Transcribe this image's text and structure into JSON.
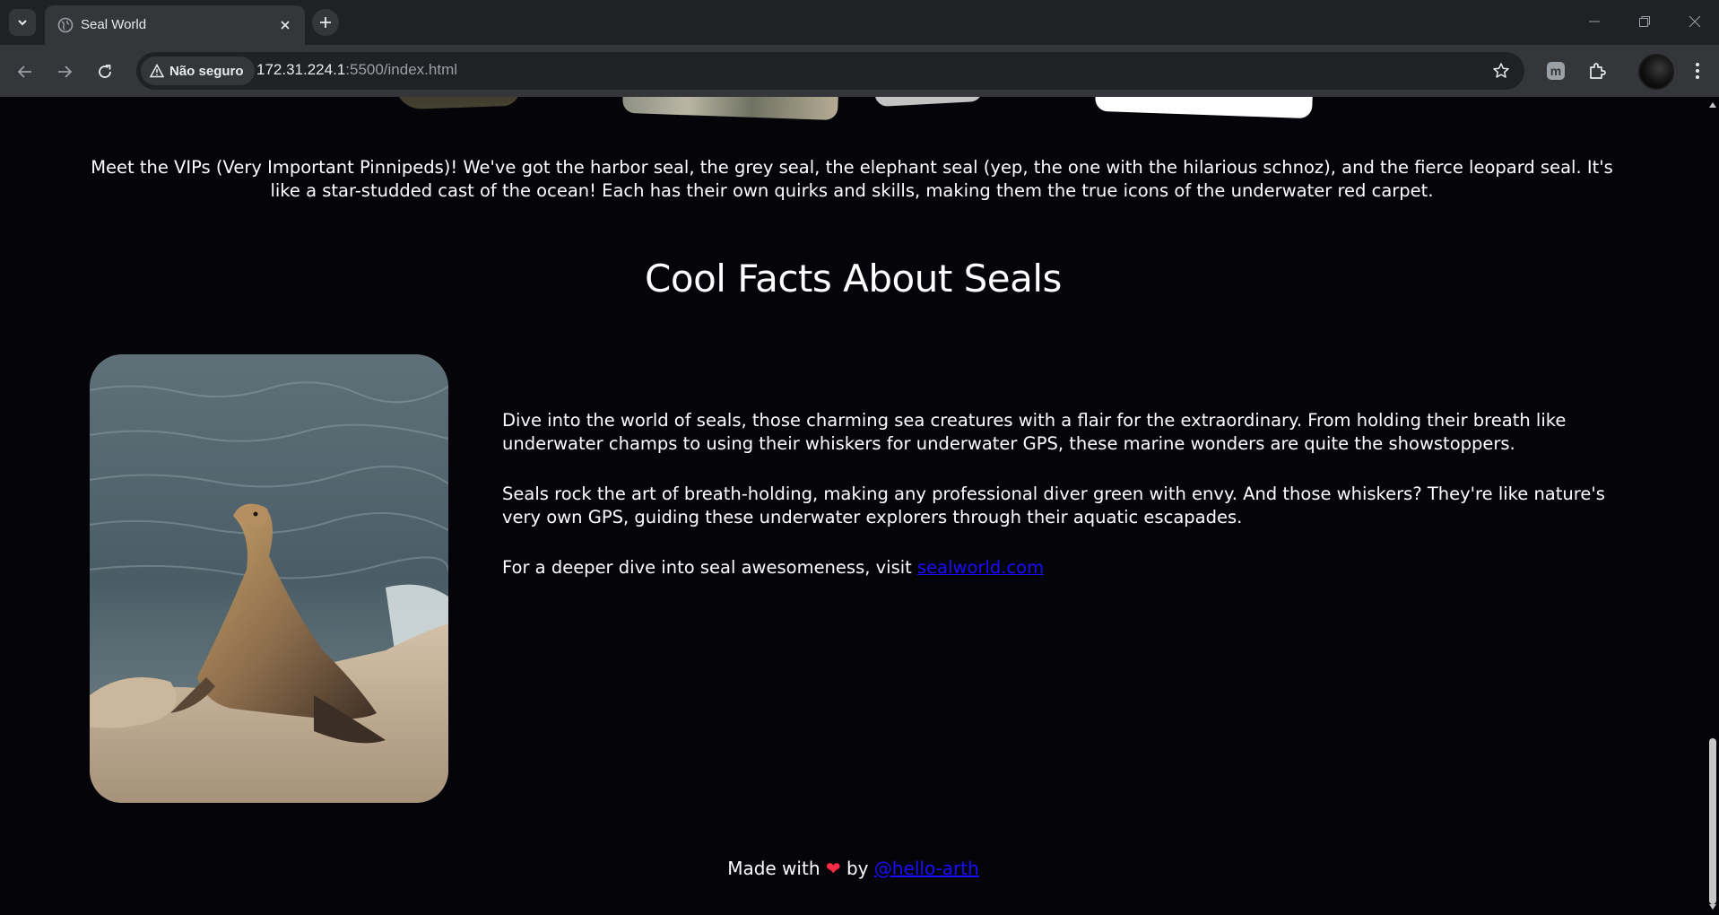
{
  "browser": {
    "tab_title": "Seal World",
    "security_label": "Não seguro",
    "url_host": "172.31.224.1",
    "url_path": ":5500/index.html"
  },
  "page": {
    "intro_text": "Meet the VIPs (Very Important Pinnipeds)! We've got the harbor seal, the grey seal, the elephant seal (yep, the one with the hilarious schnoz), and the fierce leopard seal. It's like a star-studded cast of the ocean! Each has their own quirks and skills, making them the true icons of the underwater red carpet.",
    "facts_heading": "Cool Facts About Seals",
    "facts_paragraph_1": "Dive into the world of seals, those charming sea creatures with a flair for the extraordinary. From holding their breath like underwater champs to using their whiskers for underwater GPS, these marine wonders are quite the showstoppers.",
    "facts_paragraph_2": "Seals rock the art of breath-holding, making any professional diver green with envy. And those whiskers? They're like nature's very own GPS, guiding these underwater explorers through their aquatic escapades.",
    "facts_paragraph_3_prefix": "For a deeper dive into seal awesomeness, visit ",
    "facts_link_text": "sealworld.com",
    "footer_prefix": "Made with",
    "footer_heart": "❤",
    "footer_by": "by",
    "footer_link_text": "@hello-arth"
  },
  "colors": {
    "page_background": "#050409",
    "link": "#1a0dff",
    "heart": "#ff2a44"
  },
  "icons": [
    "tab-search-icon",
    "globe-icon",
    "close-icon",
    "plus-icon",
    "minimize-icon",
    "restore-icon",
    "window-close-icon",
    "back-icon",
    "forward-icon",
    "reload-icon",
    "warning-icon",
    "star-icon",
    "extension-m-icon",
    "puzzle-icon",
    "menu-icon"
  ]
}
